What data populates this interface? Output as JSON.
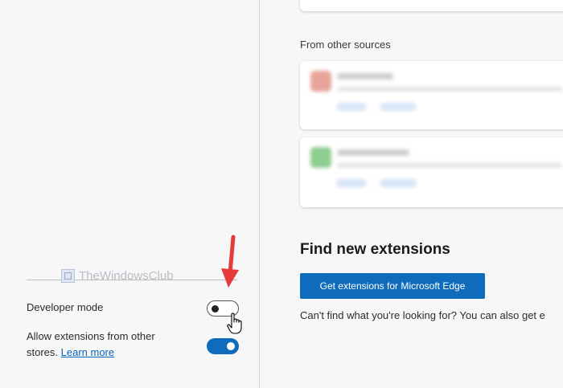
{
  "watermark": {
    "text": "TheWindowsClub"
  },
  "sidebar": {
    "developer_mode": {
      "label": "Developer mode",
      "enabled": false
    },
    "allow_other_stores": {
      "label_line1": "Allow extensions from other",
      "label_line2": "stores.",
      "learn_more": "Learn more",
      "enabled": true
    }
  },
  "main": {
    "from_other_sources_label": "From other sources",
    "extensions": [
      {
        "icon_color": "#e8a49a"
      },
      {
        "icon_color": "#8fce8f"
      }
    ],
    "find_new_heading": "Find new extensions",
    "get_extensions_button": "Get extensions for Microsoft Edge",
    "cant_find_text": "Can't find what you're looking for? You can also get e"
  },
  "colors": {
    "accent": "#0f6cbd",
    "link": "#0a64b8",
    "annotation_arrow": "#e63b3b"
  }
}
